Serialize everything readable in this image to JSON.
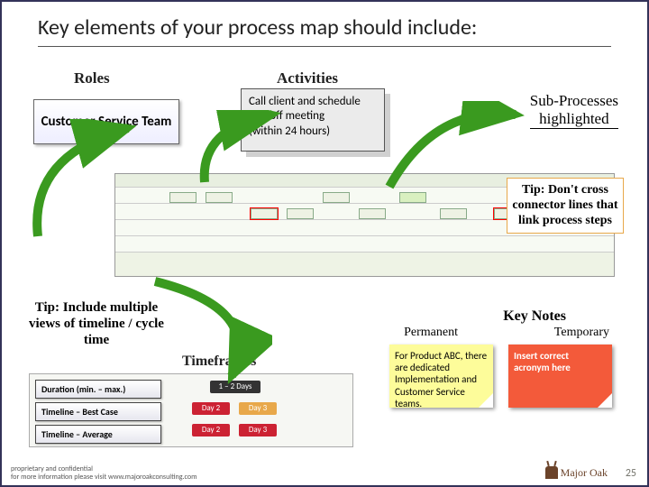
{
  "title": "Key elements of your process map should include:",
  "labels": {
    "roles": "Roles",
    "activities": "Activities",
    "timeframes": "Timeframes",
    "key_notes": "Key Notes",
    "permanent": "Permanent",
    "temporary": "Temporary"
  },
  "roles_box": "Customer Service Team",
  "activity_box": {
    "line1": "Call client and schedule kick off meeting",
    "line2": "(within 24 hours)"
  },
  "sub_processes": {
    "line1": "Sub-Processes",
    "line2": "highlighted"
  },
  "tip_right": "Tip:  Don't cross connector lines that link process steps",
  "tip_left": "Tip:  Include multiple views of timeline / cycle time",
  "timeframe_rows": {
    "r1": "Duration (min. – max.)",
    "r2": "Timeline – Best Case",
    "r3": "Timeline – Average"
  },
  "tf_bars": {
    "dur": "1 – 2 Days",
    "d2a": "Day 2",
    "d3a": "Day 3",
    "d2b": "Day 2",
    "d3b": "Day 3"
  },
  "note_yellow": "For Product ABC, there are dedicated Implementation and Customer Service teams.",
  "note_red": "Insert correct acronym here",
  "footer": {
    "l1": "proprietary and confidential",
    "l2": "for more information please visit www.majoroakconsulting.com"
  },
  "logo_text": "Major Oak",
  "page": "25"
}
